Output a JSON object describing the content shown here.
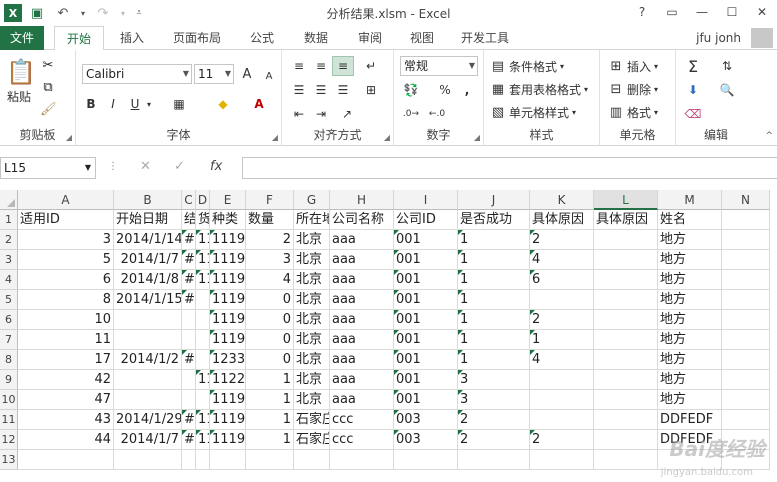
{
  "titlebar": {
    "title": "分析结果.xlsm - Excel",
    "help": "?",
    "restore": "▭",
    "minimize": "—",
    "maximize": "☐",
    "close": "✕"
  },
  "tabs": {
    "file": "文件",
    "home": "开始",
    "insert": "插入",
    "layout": "页面布局",
    "formulas": "公式",
    "data": "数据",
    "review": "审阅",
    "view": "视图",
    "developer": "开发工具",
    "user": "jfu jonh"
  },
  "ribbon": {
    "clipboard": {
      "label": "剪贴板",
      "paste": "粘贴"
    },
    "font": {
      "label": "字体",
      "font_name": "Calibri",
      "font_size": "11",
      "bold": "B",
      "italic": "I",
      "underline": "U",
      "grow": "A",
      "shrink": "A"
    },
    "alignment": {
      "label": "对齐方式"
    },
    "number": {
      "label": "数字",
      "format": "常规",
      "percent": "%",
      "comma": ","
    },
    "styles": {
      "label": "样式",
      "conditional": "条件格式",
      "table": "套用表格格式",
      "cell_styles": "单元格样式"
    },
    "cells": {
      "label": "单元格",
      "insert": "插入",
      "delete": "删除",
      "format": "格式"
    },
    "editing": {
      "label": "编辑"
    }
  },
  "formula_bar": {
    "name_box": "L15",
    "fx": "fx",
    "cancel": "✕",
    "enter": "✓"
  },
  "columns": [
    "A",
    "B",
    "C",
    "D",
    "E",
    "F",
    "G",
    "H",
    "I",
    "J",
    "K",
    "L",
    "M",
    "N"
  ],
  "selected_column": "L",
  "row_numbers": [
    "1",
    "2",
    "3",
    "4",
    "5",
    "6",
    "7",
    "8",
    "9",
    "10",
    "11",
    "12",
    "13"
  ],
  "rows": [
    [
      "适用ID",
      "开始日期",
      "结",
      "货",
      "种类",
      "数量",
      "所在地",
      "公司名称",
      "公司ID",
      "是否成功",
      "具体原因",
      "具体原因",
      "姓名",
      ""
    ],
    [
      "3",
      "2014/1/14",
      "#",
      "11",
      "1119",
      "2",
      "北京",
      "aaa",
      "001",
      "1",
      "2",
      "",
      "地方",
      ""
    ],
    [
      "5",
      "2014/1/7",
      "#",
      "11",
      "1119",
      "3",
      "北京",
      "aaa",
      "001",
      "1",
      "4",
      "",
      "地方",
      ""
    ],
    [
      "6",
      "2014/1/8",
      "#",
      "11",
      "1119",
      "4",
      "北京",
      "aaa",
      "001",
      "1",
      "6",
      "",
      "地方",
      ""
    ],
    [
      "8",
      "2014/1/15",
      "#",
      "",
      "1119",
      "0",
      "北京",
      "aaa",
      "001",
      "1",
      "",
      "",
      "地方",
      ""
    ],
    [
      "10",
      "",
      "",
      "",
      "1119",
      "0",
      "北京",
      "aaa",
      "001",
      "1",
      "2",
      "",
      "地方",
      ""
    ],
    [
      "11",
      "",
      "",
      "",
      "1119",
      "0",
      "北京",
      "aaa",
      "001",
      "1",
      "1",
      "",
      "地方",
      ""
    ],
    [
      "17",
      "2014/1/2",
      "#",
      "",
      "1233",
      "0",
      "北京",
      "aaa",
      "001",
      "1",
      "4",
      "",
      "地方",
      ""
    ],
    [
      "42",
      "",
      "",
      "11",
      "1122",
      "1",
      "北京",
      "aaa",
      "001",
      "3",
      "",
      "",
      "地方",
      ""
    ],
    [
      "47",
      "",
      "",
      "",
      "1119",
      "1",
      "北京",
      "aaa",
      "001",
      "3",
      "",
      "",
      "地方",
      ""
    ],
    [
      "43",
      "2014/1/29",
      "#",
      "11",
      "1119",
      "1",
      "石家庄",
      "ccc",
      "003",
      "2",
      "",
      "",
      "DDFEDF",
      ""
    ],
    [
      "44",
      "2014/1/7",
      "#",
      "11",
      "1119",
      "1",
      "石家庄",
      "ccc",
      "003",
      "2",
      "2",
      "",
      "DDFEDF",
      ""
    ],
    [
      "",
      "",
      "",
      "",
      "",
      "",
      "",
      "",
      "",
      "",
      "",
      "",
      "",
      ""
    ]
  ],
  "watermark": {
    "main": "Bai度经验",
    "sub": "jingyan.baidu.com"
  },
  "colors": {
    "accent": "#217346",
    "error_triangle": "#1e7145"
  }
}
